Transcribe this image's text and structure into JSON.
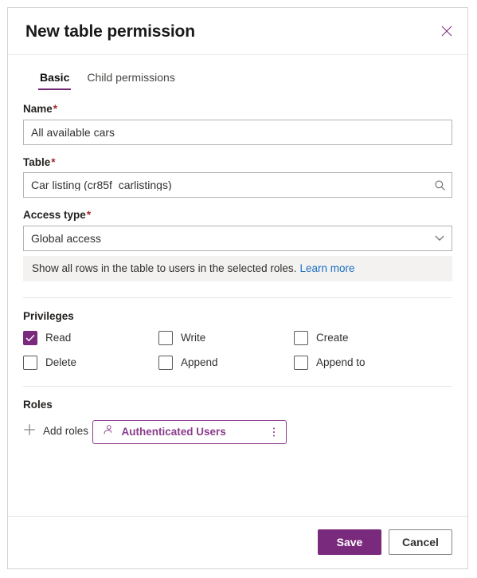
{
  "dialog": {
    "title": "New table permission",
    "close_icon": "close-icon"
  },
  "tabs": [
    {
      "label": "Basic",
      "active": true
    },
    {
      "label": "Child permissions",
      "active": false
    }
  ],
  "fields": {
    "name": {
      "label": "Name",
      "required_mark": "*",
      "value": "All available cars",
      "placeholder": "Name"
    },
    "table": {
      "label": "Table",
      "required_mark": "*",
      "value": "Car listing (cr85f_carlistings)",
      "placeholder": "Table",
      "icon": "search-icon"
    },
    "access_type": {
      "label": "Access type",
      "required_mark": "*",
      "value": "Global access",
      "icon": "chevron-down-icon",
      "options": [
        "Global access"
      ]
    }
  },
  "infobar": {
    "text": "Show all rows in the table to users in the selected roles.",
    "link_label": "Learn more"
  },
  "privileges": {
    "title": "Privileges",
    "items": [
      {
        "label": "Read",
        "checked": true
      },
      {
        "label": "Write",
        "checked": false
      },
      {
        "label": "Create",
        "checked": false
      },
      {
        "label": "Delete",
        "checked": false
      },
      {
        "label": "Append",
        "checked": false
      },
      {
        "label": "Append to",
        "checked": false
      }
    ]
  },
  "roles": {
    "title": "Roles",
    "add_label": "Add roles",
    "add_icon": "plus-icon",
    "items": [
      {
        "name": "Authenticated Users",
        "icon": "person-icon",
        "more_icon": "more-vertical-icon"
      }
    ]
  },
  "footer": {
    "save_label": "Save",
    "cancel_label": "Cancel"
  },
  "colors": {
    "accent": "#7a2a7d",
    "accent_light": "#8b3d8b",
    "link": "#1a6fc4",
    "required": "#a4262c",
    "infobar_bg": "#f3f2f1"
  }
}
